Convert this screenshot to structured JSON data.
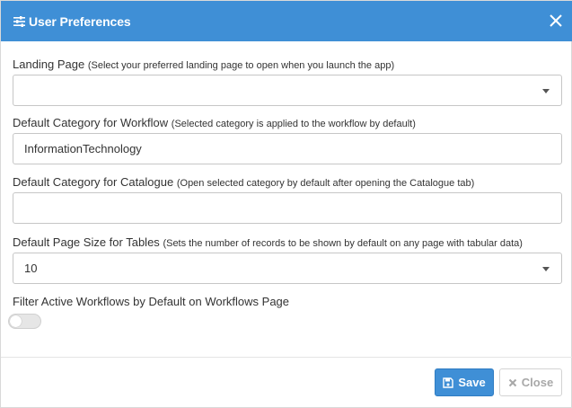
{
  "dialog": {
    "title": "User Preferences",
    "header_icon": "sliders-icon",
    "close_icon": "close-icon",
    "accent_color": "#3f8fd6"
  },
  "fields": [
    {
      "label": "Landing Page",
      "hint": "(Select your preferred landing page to open when you launch the app)",
      "value": "",
      "type": "select"
    },
    {
      "label": "Default Category for Workflow",
      "hint": "(Selected category is applied to the workflow by default)",
      "value": "InformationTechnology",
      "type": "text"
    },
    {
      "label": "Default Category for Catalogue",
      "hint": "(Open selected category by default after opening the Catalogue tab)",
      "value": "",
      "type": "text"
    },
    {
      "label": "Default Page Size for Tables",
      "hint": "(Sets the number of records to be shown by default on any page with tabular data)",
      "value": "10",
      "type": "select"
    }
  ],
  "toggle": {
    "label": "Filter Active Workflows by Default on Workflows Page",
    "checked": false
  },
  "footer": {
    "save_label": "Save",
    "save_icon": "floppy-disk-icon",
    "close_label": "Close",
    "close_icon": "times-icon"
  }
}
